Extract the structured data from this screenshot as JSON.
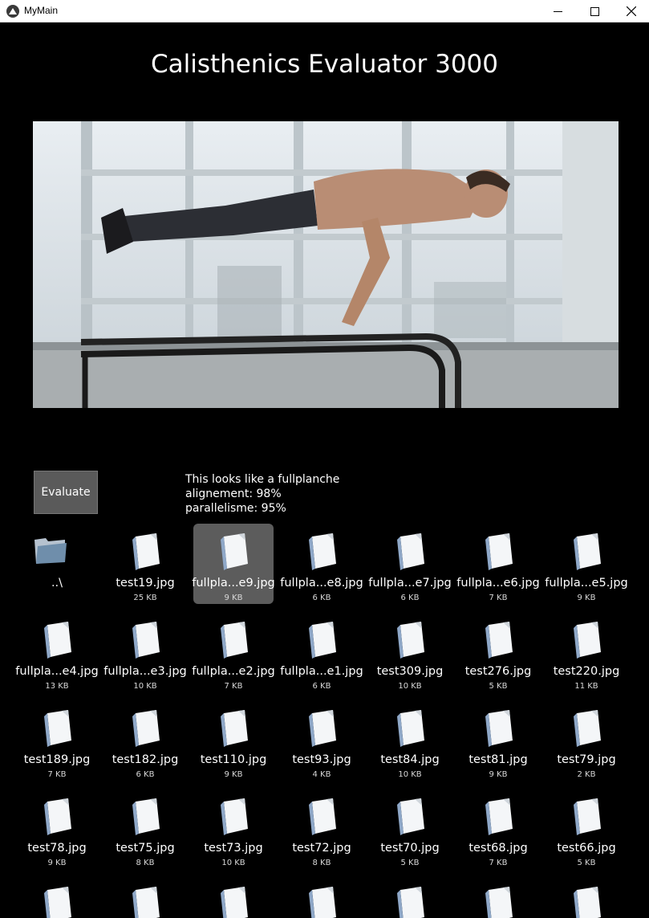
{
  "window": {
    "title": "MyMain"
  },
  "heading": "Calisthenics Evaluator 3000",
  "evaluate_button": "Evaluate",
  "result": {
    "line1": "This looks like a fullplanche",
    "line2": "alignement: 98%",
    "line3": "parallelisme: 95%"
  },
  "files": [
    {
      "name": "..\\",
      "size": "",
      "type": "folder"
    },
    {
      "name": "test19.jpg",
      "size": "25 KB",
      "type": "file"
    },
    {
      "name": "fullpla...e9.jpg",
      "size": "9 KB",
      "type": "file",
      "selected": true
    },
    {
      "name": "fullpla...e8.jpg",
      "size": "6 KB",
      "type": "file"
    },
    {
      "name": "fullpla...e7.jpg",
      "size": "6 KB",
      "type": "file"
    },
    {
      "name": "fullpla...e6.jpg",
      "size": "7 KB",
      "type": "file"
    },
    {
      "name": "fullpla...e5.jpg",
      "size": "9 KB",
      "type": "file"
    },
    {
      "name": "fullpla...e4.jpg",
      "size": "13 KB",
      "type": "file"
    },
    {
      "name": "fullpla...e3.jpg",
      "size": "10 KB",
      "type": "file"
    },
    {
      "name": "fullpla...e2.jpg",
      "size": "7 KB",
      "type": "file"
    },
    {
      "name": "fullpla...e1.jpg",
      "size": "6 KB",
      "type": "file"
    },
    {
      "name": "test309.jpg",
      "size": "10 KB",
      "type": "file"
    },
    {
      "name": "test276.jpg",
      "size": "5 KB",
      "type": "file"
    },
    {
      "name": "test220.jpg",
      "size": "11 KB",
      "type": "file"
    },
    {
      "name": "test189.jpg",
      "size": "7 KB",
      "type": "file"
    },
    {
      "name": "test182.jpg",
      "size": "6 KB",
      "type": "file"
    },
    {
      "name": "test110.jpg",
      "size": "9 KB",
      "type": "file"
    },
    {
      "name": "test93.jpg",
      "size": "4 KB",
      "type": "file"
    },
    {
      "name": "test84.jpg",
      "size": "10 KB",
      "type": "file"
    },
    {
      "name": "test81.jpg",
      "size": "9 KB",
      "type": "file"
    },
    {
      "name": "test79.jpg",
      "size": "2 KB",
      "type": "file"
    },
    {
      "name": "test78.jpg",
      "size": "9 KB",
      "type": "file"
    },
    {
      "name": "test75.jpg",
      "size": "8 KB",
      "type": "file"
    },
    {
      "name": "test73.jpg",
      "size": "10 KB",
      "type": "file"
    },
    {
      "name": "test72.jpg",
      "size": "8 KB",
      "type": "file"
    },
    {
      "name": "test70.jpg",
      "size": "5 KB",
      "type": "file"
    },
    {
      "name": "test68.jpg",
      "size": "7 KB",
      "type": "file"
    },
    {
      "name": "test66.jpg",
      "size": "5 KB",
      "type": "file"
    },
    {
      "name": "",
      "size": "",
      "type": "file"
    },
    {
      "name": "",
      "size": "",
      "type": "file"
    },
    {
      "name": "",
      "size": "",
      "type": "file"
    },
    {
      "name": "",
      "size": "",
      "type": "file"
    },
    {
      "name": "",
      "size": "",
      "type": "file"
    },
    {
      "name": "",
      "size": "",
      "type": "file"
    },
    {
      "name": "",
      "size": "",
      "type": "file"
    }
  ],
  "icons": {
    "app": "kivy-logo-icon",
    "minimize": "minimize-icon",
    "maximize": "maximize-icon",
    "close": "close-icon",
    "folder": "folder-icon",
    "file": "file-icon"
  },
  "colors": {
    "background": "#000000",
    "selected_tile": "#5c5c5c",
    "button": "#5a5a5a"
  }
}
